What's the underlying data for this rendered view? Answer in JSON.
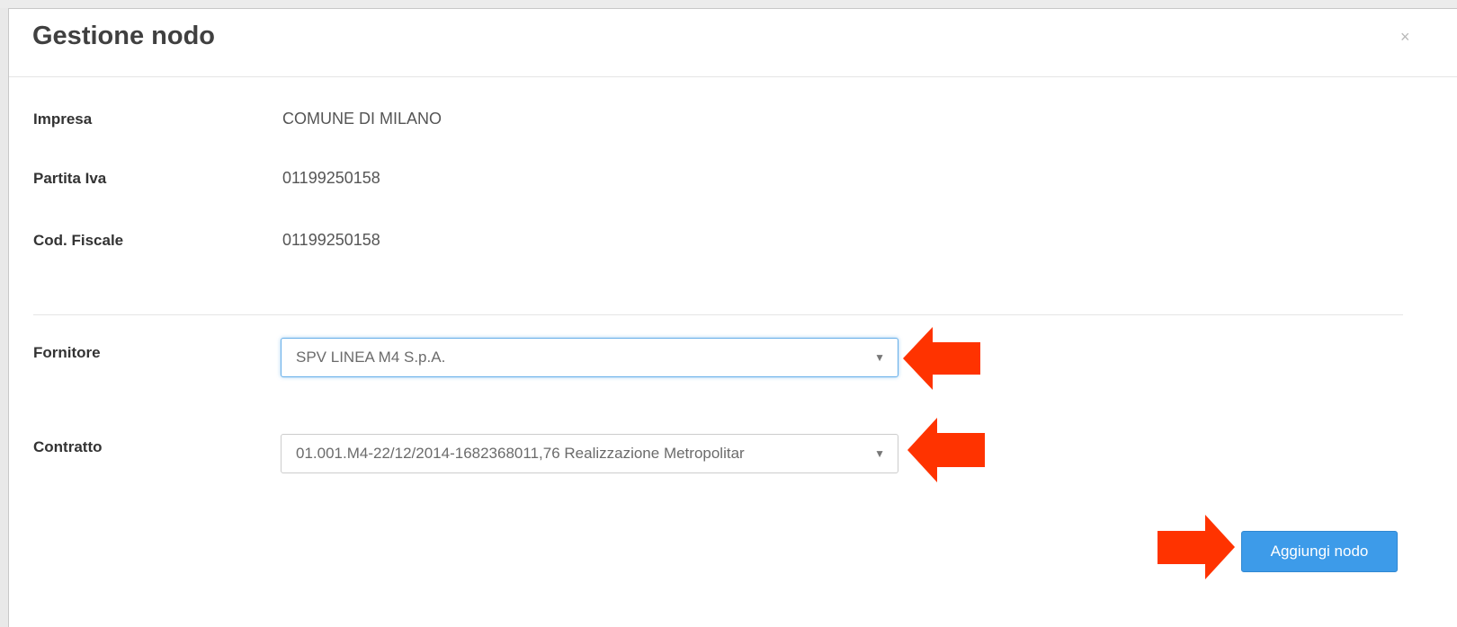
{
  "dialog": {
    "title": "Gestione nodo",
    "close_label": "×"
  },
  "company": {
    "fields": [
      {
        "label": "Impresa",
        "value": "COMUNE DI MILANO"
      },
      {
        "label": "Partita Iva",
        "value": "01199250158"
      },
      {
        "label": "Cod. Fiscale",
        "value": "01199250158"
      }
    ]
  },
  "form": {
    "supplier": {
      "label": "Fornitore",
      "selected": "SPV LINEA M4 S.p.A."
    },
    "contract": {
      "label": "Contratto",
      "selected": "01.001.M4-22/12/2014-1682368011,76 Realizzazione Metropolitar"
    },
    "caret": "▼"
  },
  "actions": {
    "add_node_label": "Aggiungi nodo"
  },
  "colors": {
    "accent": "#3d9be9",
    "annotation_arrow": "#ff3300",
    "focus_border": "#66afe9"
  },
  "icons": [
    "close-icon",
    "chevron-down-icon",
    "annotation-arrow-icon"
  ]
}
